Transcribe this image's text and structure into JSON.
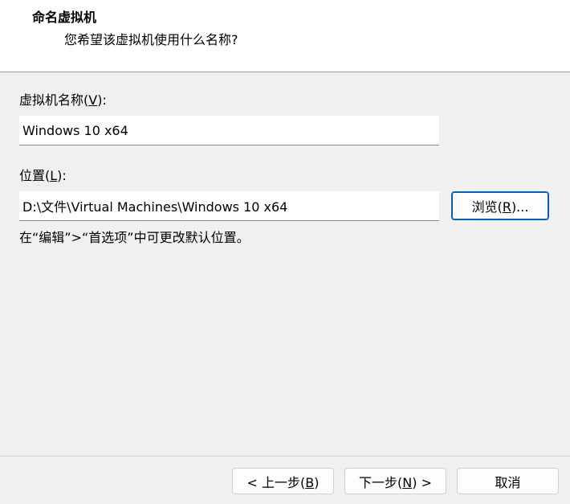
{
  "header": {
    "title": "命名虚拟机",
    "subtitle": "您希望该虚拟机使用什么名称?"
  },
  "vm_name": {
    "label_prefix": "虚拟机名称(",
    "label_key": "V",
    "label_suffix": "):",
    "value": "Windows 10 x64"
  },
  "location": {
    "label_prefix": "位置(",
    "label_key": "L",
    "label_suffix": "):",
    "value": "D:\\文件\\Virtual Machines\\Windows 10 x64",
    "browse_prefix": "浏览(",
    "browse_key": "R",
    "browse_suffix": ")..."
  },
  "hint": "在“编辑”>“首选项”中可更改默认位置。",
  "footer": {
    "back_prefix": "< 上一步(",
    "back_key": "B",
    "back_suffix": ")",
    "next_prefix": "下一步(",
    "next_key": "N",
    "next_suffix": ") >",
    "cancel_label": "取消"
  },
  "colors": {
    "accent": "#005fb8",
    "background": "#f0f0f0",
    "header_background": "#ffffff"
  }
}
